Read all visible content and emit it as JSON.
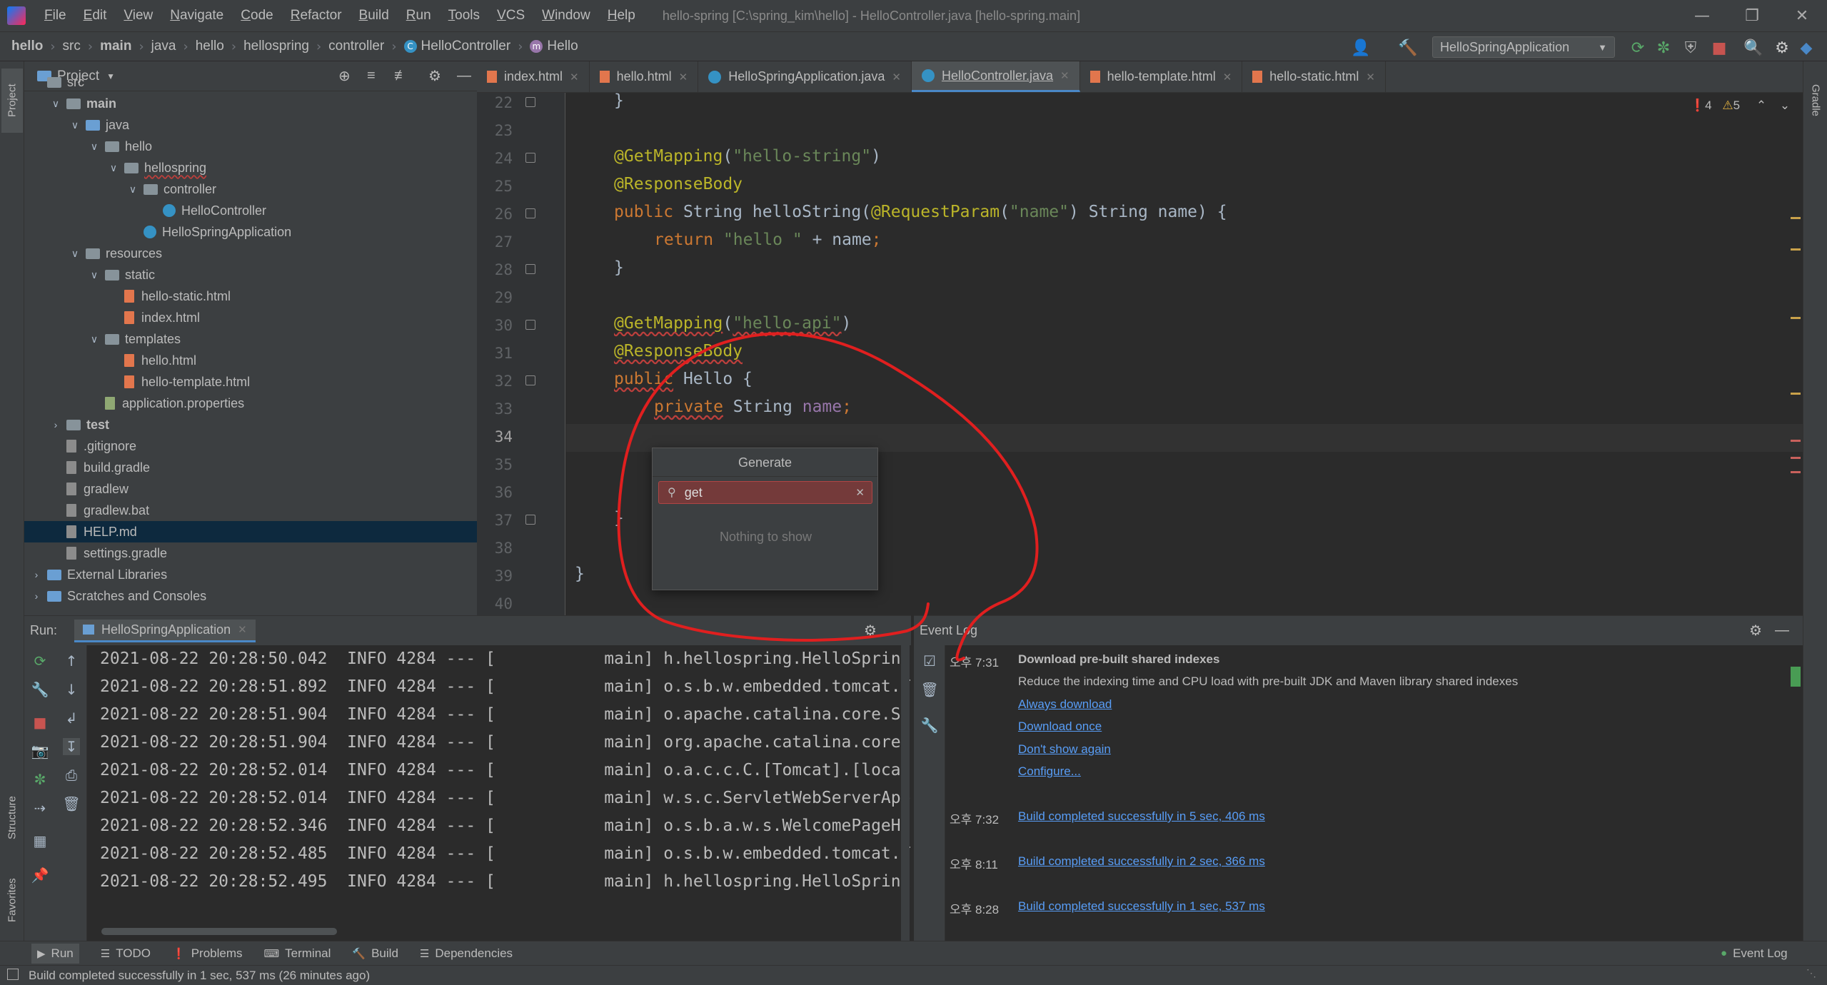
{
  "titlebar": {
    "menu": [
      "File",
      "Edit",
      "View",
      "Navigate",
      "Code",
      "Refactor",
      "Build",
      "Run",
      "Tools",
      "VCS",
      "Window",
      "Help"
    ],
    "window_title": "hello-spring [C:\\spring_kim\\hello] - HelloController.java [hello-spring.main]"
  },
  "breadcrumb": [
    "hello",
    "src",
    "main",
    "java",
    "hello",
    "hellospring",
    "controller",
    "HelloController",
    "Hello"
  ],
  "toolbar": {
    "run_config": "HelloSpringApplication"
  },
  "project": {
    "header": "Project",
    "tree": [
      {
        "label": "src",
        "indent": 0,
        "kind": "folder"
      },
      {
        "label": "main",
        "indent": 1,
        "kind": "folder",
        "arrow": "open"
      },
      {
        "label": "java",
        "indent": 2,
        "kind": "folder-blue",
        "arrow": "open"
      },
      {
        "label": "hello",
        "indent": 3,
        "kind": "folder",
        "arrow": "open"
      },
      {
        "label": "hellospring",
        "indent": 4,
        "kind": "folder",
        "arrow": "open"
      },
      {
        "label": "controller",
        "indent": 5,
        "kind": "folder",
        "arrow": "open"
      },
      {
        "label": "HelloController",
        "indent": 6,
        "kind": "class"
      },
      {
        "label": "HelloSpringApplication",
        "indent": 5,
        "kind": "class"
      },
      {
        "label": "resources",
        "indent": 2,
        "kind": "folder",
        "arrow": "open"
      },
      {
        "label": "static",
        "indent": 3,
        "kind": "folder",
        "arrow": "open"
      },
      {
        "label": "hello-static.html",
        "indent": 4,
        "kind": "html"
      },
      {
        "label": "index.html",
        "indent": 4,
        "kind": "html"
      },
      {
        "label": "templates",
        "indent": 3,
        "kind": "folder",
        "arrow": "open"
      },
      {
        "label": "hello.html",
        "indent": 4,
        "kind": "html"
      },
      {
        "label": "hello-template.html",
        "indent": 4,
        "kind": "html"
      },
      {
        "label": "application.properties",
        "indent": 3,
        "kind": "props"
      },
      {
        "label": "test",
        "indent": 1,
        "kind": "folder",
        "arrow": "closed"
      },
      {
        "label": ".gitignore",
        "indent": 1,
        "kind": "gray"
      },
      {
        "label": "build.gradle",
        "indent": 1,
        "kind": "gray"
      },
      {
        "label": "gradlew",
        "indent": 1,
        "kind": "gray"
      },
      {
        "label": "gradlew.bat",
        "indent": 1,
        "kind": "gray"
      },
      {
        "label": "HELP.md",
        "indent": 1,
        "kind": "gray",
        "selected": true
      },
      {
        "label": "settings.gradle",
        "indent": 1,
        "kind": "gray"
      },
      {
        "label": "External Libraries",
        "indent": 0,
        "kind": "lib",
        "arrow": "closed"
      },
      {
        "label": "Scratches and Consoles",
        "indent": 0,
        "kind": "lib",
        "arrow": "closed"
      }
    ]
  },
  "editor": {
    "tabs": [
      "index.html",
      "hello.html",
      "HelloSpringApplication.java",
      "HelloController.java",
      "hello-template.html",
      "hello-static.html"
    ],
    "active_tab": 3,
    "errors": "4",
    "warnings": "5",
    "line_numbers": [
      "22",
      "23",
      "24",
      "25",
      "26",
      "27",
      "28",
      "29",
      "30",
      "31",
      "32",
      "33",
      "34",
      "35",
      "36",
      "37",
      "38",
      "39",
      "40"
    ],
    "current_line": "34"
  },
  "generate_popup": {
    "title": "Generate",
    "query": "get",
    "empty_text": "Nothing to show"
  },
  "run": {
    "label": "Run:",
    "tab": "HelloSpringApplication",
    "lines": [
      "2021-08-22 20:28:50.042  INFO 4284 --- [           main] h.hellospring.HelloSpringApplication",
      "2021-08-22 20:28:51.892  INFO 4284 --- [           main] o.s.b.w.embedded.tomcat.TomcatWebServer",
      "2021-08-22 20:28:51.904  INFO 4284 --- [           main] o.apache.catalina.core.StandardService",
      "2021-08-22 20:28:51.904  INFO 4284 --- [           main] org.apache.catalina.core.StandardEngine",
      "2021-08-22 20:28:52.014  INFO 4284 --- [           main] o.a.c.c.C.[Tomcat].[localhost].[/]",
      "2021-08-22 20:28:52.014  INFO 4284 --- [           main] w.s.c.ServletWebServerApplicationContext",
      "2021-08-22 20:28:52.346  INFO 4284 --- [           main] o.s.b.a.w.s.WelcomePageHandlerMapping",
      "2021-08-22 20:28:52.485  INFO 4284 --- [           main] o.s.b.w.embedded.tomcat.TomcatWebServer",
      "2021-08-22 20:28:52.495  INFO 4284 --- [           main] h.hellospring.HelloSpringApplication"
    ]
  },
  "event_log": {
    "title": "Event Log",
    "entries": [
      {
        "time": "오후 7:31",
        "title": "Download pre-built shared indexes",
        "text": "Reduce the indexing time and CPU load with pre-built JDK and Maven library shared indexes",
        "links": [
          "Always download",
          "Download once",
          "Don't show again",
          "Configure..."
        ]
      },
      {
        "time": "오후 7:32",
        "link": "Build completed successfully in 5 sec, 406 ms"
      },
      {
        "time": "오후 8:11",
        "link": "Build completed successfully in 2 sec, 366 ms"
      },
      {
        "time": "오후 8:28",
        "link": "Build completed successfully in 1 sec, 537 ms"
      }
    ]
  },
  "bottom_tools": [
    "Run",
    "TODO",
    "Problems",
    "Terminal",
    "Build",
    "Dependencies"
  ],
  "bottom_right": "Event Log",
  "status": "Build completed successfully in 1 sec, 537 ms (26 minutes ago)",
  "side_tabs": {
    "left_top": "Project",
    "left_mid": "Structure",
    "left_bottom": "Favorites",
    "right_top": "Gradle"
  },
  "colors": {
    "accent": "#4a88c7",
    "annotation": "#e01f1f",
    "keyword": "#cc7832",
    "string": "#6a8759",
    "annotation_code": "#bbb529"
  }
}
